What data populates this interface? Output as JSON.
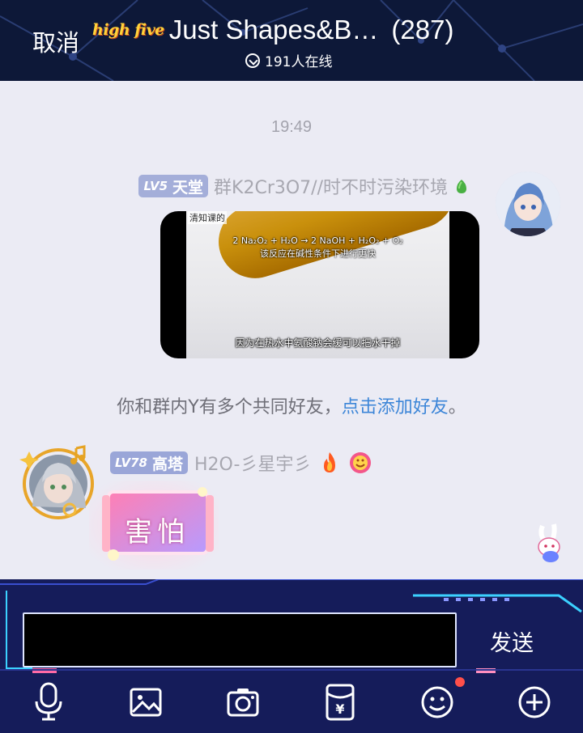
{
  "header": {
    "cancel_label": "取消",
    "brand_logo_text": "high five",
    "group_title": "Just Shapes&B…",
    "member_count": "(287)",
    "online_text": "191人在线"
  },
  "chat": {
    "timestamp": "19:49",
    "message1": {
      "level": "LV5",
      "title": "天堂",
      "nickname": "群K2Cr3O7//时不时污染环境",
      "video": {
        "top_caption": "清知课的",
        "equation": "2 Na₂O₂ + H₂O → 2 NaOH + H₂O₂ + O₂",
        "note": "该反应在碱性条件下进行更快",
        "bottom_caption": "因为在热水中氨酸钠会缓可以把水干掉"
      }
    },
    "system_note": {
      "text": "你和群内Y有多个共同好友，",
      "link": "点击添加好友",
      "suffix": "。"
    },
    "message2": {
      "level": "LV78",
      "title": "高塔",
      "nickname": "H2O-彡星宇彡",
      "sticker_text": "害怕"
    }
  },
  "input": {
    "value": "",
    "send_label": "发送"
  },
  "toolbar": {
    "icons": [
      "microphone-icon",
      "image-icon",
      "camera-icon",
      "red-packet-icon",
      "emoji-icon",
      "plus-icon"
    ]
  },
  "colors": {
    "header_bg": "#0d1838",
    "chat_bg": "#ebebf4",
    "panel_bg": "#151c5a",
    "link": "#3d86d8",
    "level_badge": "#a4aed9",
    "notification_dot": "#ff4f4a"
  }
}
